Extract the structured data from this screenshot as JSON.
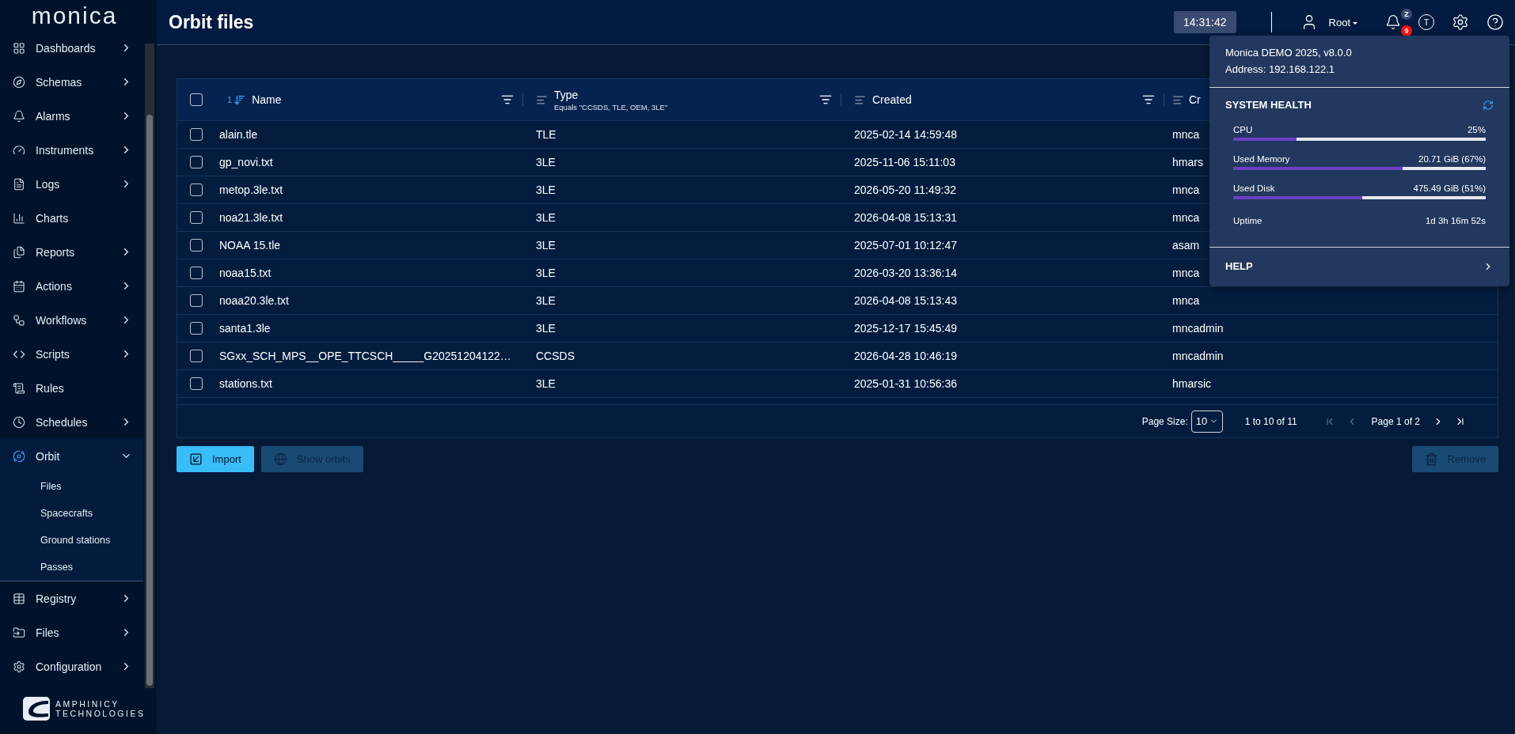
{
  "brand": {
    "logo": "monica",
    "company": "AMPHINICY",
    "company_sub": "TECHNOLOGIES"
  },
  "sidebar": {
    "items": [
      {
        "label": "Dashboards",
        "expandable": true,
        "expanded": false,
        "selected": false
      },
      {
        "label": "Schemas",
        "expandable": true,
        "expanded": false,
        "selected": false
      },
      {
        "label": "Alarms",
        "expandable": true,
        "expanded": false,
        "selected": false
      },
      {
        "label": "Instruments",
        "expandable": true,
        "expanded": false,
        "selected": false
      },
      {
        "label": "Logs",
        "expandable": true,
        "expanded": false,
        "selected": false
      },
      {
        "label": "Charts",
        "expandable": false,
        "expanded": false,
        "selected": false
      },
      {
        "label": "Reports",
        "expandable": true,
        "expanded": false,
        "selected": false
      },
      {
        "label": "Actions",
        "expandable": true,
        "expanded": false,
        "selected": false
      },
      {
        "label": "Workflows",
        "expandable": true,
        "expanded": false,
        "selected": false
      },
      {
        "label": "Scripts",
        "expandable": true,
        "expanded": false,
        "selected": false
      },
      {
        "label": "Rules",
        "expandable": false,
        "expanded": false,
        "selected": false
      },
      {
        "label": "Schedules",
        "expandable": true,
        "expanded": false,
        "selected": false
      },
      {
        "label": "Orbit",
        "expandable": true,
        "expanded": true,
        "selected": true,
        "children": [
          {
            "label": "Files"
          },
          {
            "label": "Spacecrafts"
          },
          {
            "label": "Ground stations"
          },
          {
            "label": "Passes"
          }
        ]
      },
      {
        "label": "Registry",
        "expandable": true,
        "expanded": false,
        "selected": false
      },
      {
        "label": "Files",
        "expandable": true,
        "expanded": false,
        "selected": false
      },
      {
        "label": "Configuration",
        "expandable": true,
        "expanded": false,
        "selected": false
      }
    ]
  },
  "header": {
    "title": "Orbit files",
    "clock": "14:31:42",
    "user": "Root",
    "notification_badge": "Z",
    "alarm_badge": "9",
    "theme_button": "T"
  },
  "table": {
    "header_checked": false,
    "columns": [
      {
        "label": "Name",
        "sort_index": "1",
        "sorted": true
      },
      {
        "label": "Type",
        "sorted": false,
        "filter": "Equals \"CCSDS, TLE, OEM, 3LE\""
      },
      {
        "label": "Created",
        "sorted": false
      },
      {
        "label": "Cr",
        "sorted": false
      }
    ],
    "rows": [
      {
        "checked": false,
        "name": "alain.tle",
        "type": "TLE",
        "created": "2025-02-14 14:59:48",
        "column_4": "mnca"
      },
      {
        "checked": false,
        "name": "gp_novi.txt",
        "type": "3LE",
        "created": "2025-11-06 15:11:03",
        "column_4": "hmars"
      },
      {
        "checked": false,
        "name": "metop.3le.txt",
        "type": "3LE",
        "created": "2026-05-20 11:49:32",
        "column_4": "mnca"
      },
      {
        "checked": false,
        "name": "noa21.3le.txt",
        "type": "3LE",
        "created": "2026-04-08 15:13:31",
        "column_4": "mnca"
      },
      {
        "checked": false,
        "name": "NOAA 15.tle",
        "type": "3LE",
        "created": "2025-07-01 10:12:47",
        "column_4": "asam"
      },
      {
        "checked": false,
        "name": "noaa15.txt",
        "type": "3LE",
        "created": "2026-03-20 13:36:14",
        "column_4": "mnca"
      },
      {
        "checked": false,
        "name": "noaa20.3le.txt",
        "type": "3LE",
        "created": "2026-04-08 15:13:43",
        "column_4": "mnca"
      },
      {
        "checked": false,
        "name": "santa1.3le",
        "type": "3LE",
        "created": "2025-12-17 15:45:49",
        "column_4": "mncadmin"
      },
      {
        "checked": false,
        "name": "SGxx_SCH_MPS__OPE_TTCSCH_____G20251204122…",
        "type": "CCSDS",
        "created": "2026-04-28 10:46:19",
        "column_4": "mncadmin"
      },
      {
        "checked": false,
        "name": "stations.txt",
        "type": "3LE",
        "created": "2025-01-31 10:56:36",
        "column_4": "hmarsic"
      }
    ],
    "pagination": {
      "page_size_label": "Page Size:",
      "page_size": "10",
      "range": "1 to 10 of 11",
      "page": "Page 1 of 2",
      "first_disabled": true,
      "last_disabled": false
    }
  },
  "actions": [
    {
      "label": "Import",
      "disabled": false
    },
    {
      "label": "Show orbits",
      "disabled": true
    },
    {
      "label": "Remove",
      "disabled": true
    }
  ],
  "popup": {
    "app": "Monica DEMO 2025, v8.0.0",
    "address": "Address: 192.168.122.1",
    "health_title": "SYSTEM HEALTH",
    "metrics": [
      {
        "label": "CPU",
        "reading": "25%",
        "level": 0.25
      },
      {
        "label": "Used Memory",
        "reading": "20.71 GiB (67%)",
        "level": 0.67
      },
      {
        "label": "Used Disk",
        "reading": "475.49 GiB (51%)",
        "level": 0.51
      }
    ],
    "uptime_label": "Uptime",
    "uptime": "1d 3h 16m 52s",
    "help": "HELP"
  }
}
